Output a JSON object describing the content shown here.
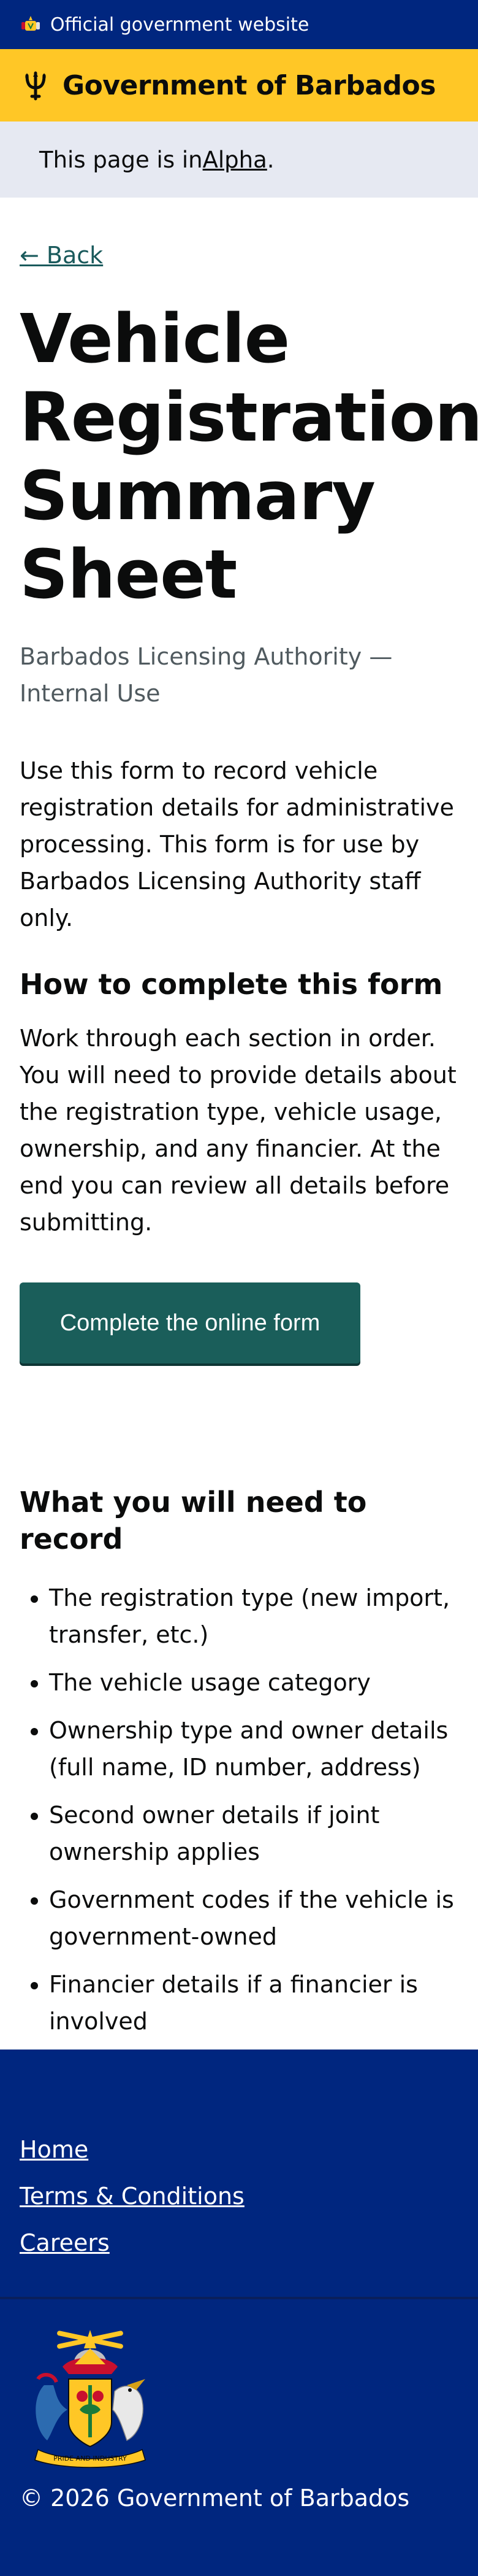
{
  "official_banner": {
    "text": "Official government website"
  },
  "header": {
    "title": "Government of Barbados"
  },
  "phase_banner": {
    "prefix": "This page is in ",
    "link": "Alpha",
    "suffix": "."
  },
  "back_link": {
    "label": "← Back"
  },
  "page": {
    "title": "Vehicle Registration Summary Sheet",
    "caption": "Barbados Licensing Authority — Internal Use",
    "intro": "Use this form to record vehicle registration details for administrative processing. This form is for use by Barbados Licensing Authority staff only."
  },
  "how_to": {
    "heading": "How to complete this form",
    "text": "Work through each section in order. You will need to provide details about the registration type, vehicle usage, ownership, and any financier. At the end you can review all details before submitting."
  },
  "start_button": {
    "label": "Complete the online form"
  },
  "need": {
    "heading": "What you will need to record",
    "items": [
      "The registration type (new import, transfer, etc.)",
      "The vehicle usage category",
      "Ownership type and owner details (full name, ID number, address)",
      "Second owner details if joint ownership applies",
      "Government codes if the vehicle is government-owned",
      "Financier details if a financier is involved"
    ]
  },
  "footer": {
    "links": [
      "Home",
      "Terms & Conditions",
      "Careers"
    ],
    "copyright": "© 2026 Government of Barbados"
  },
  "colors": {
    "navy": "#00267f",
    "gold": "#ffc726",
    "teal_button": "#1a5e5a",
    "phase_bg": "#e6e9f2"
  }
}
